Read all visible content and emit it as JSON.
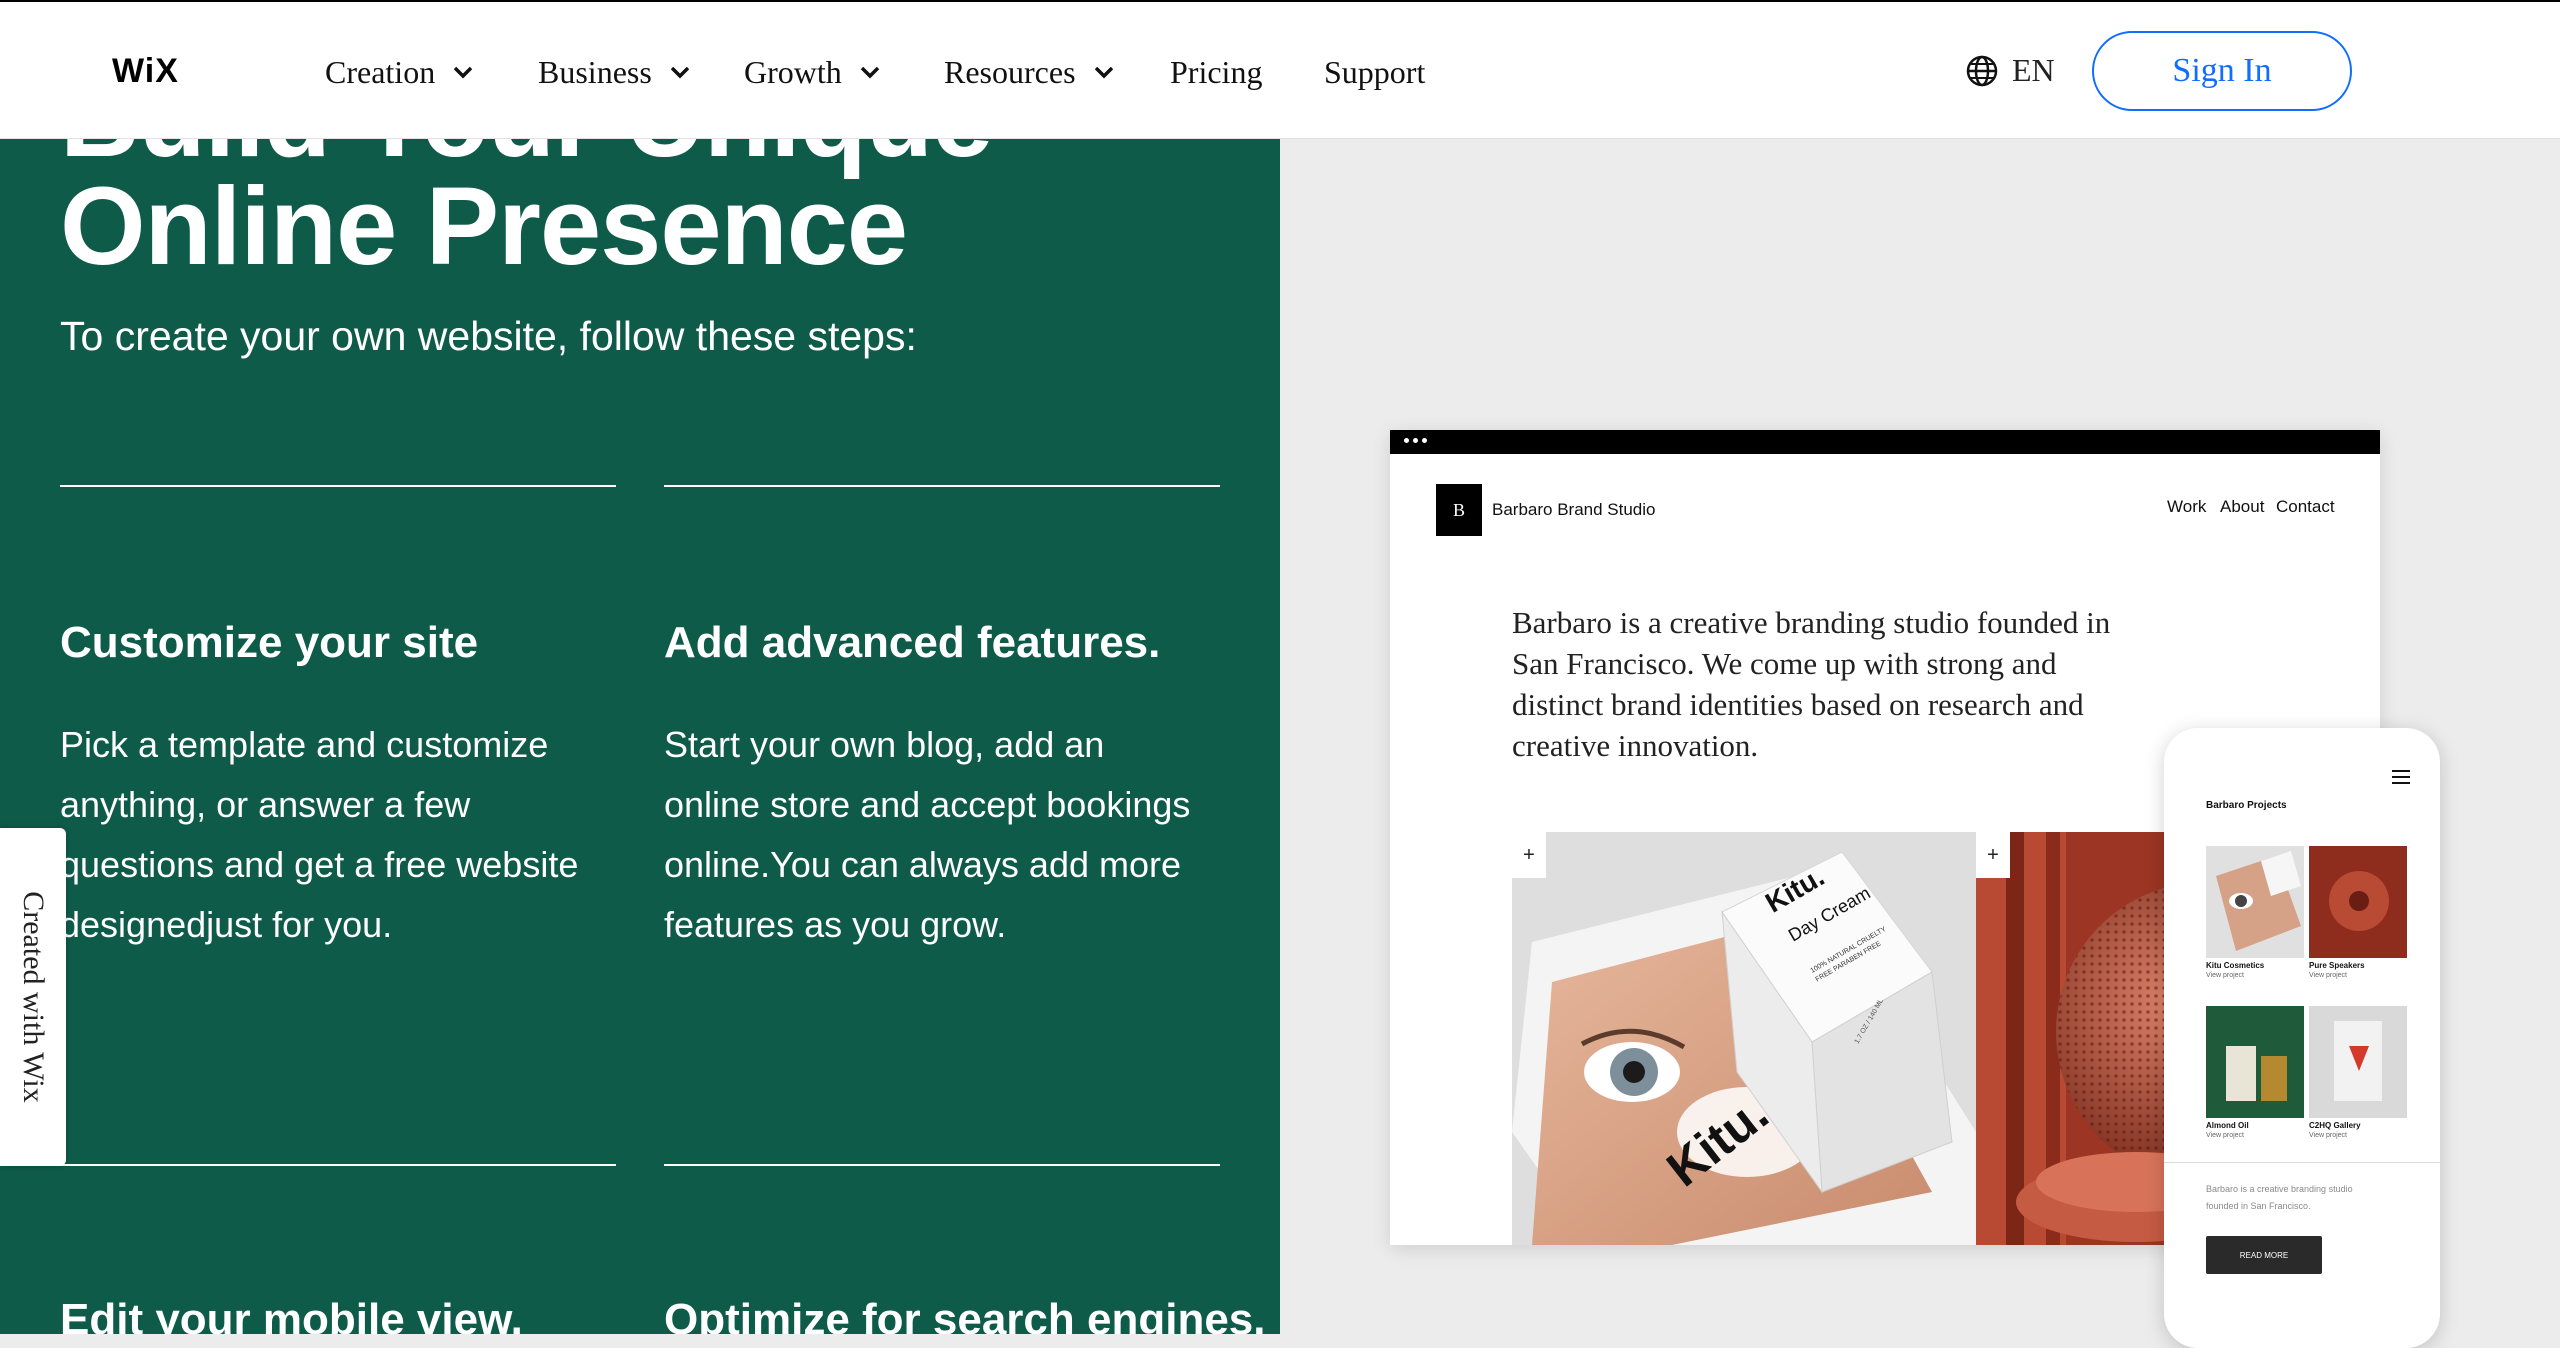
{
  "nav": {
    "logo": "WiX",
    "items": [
      {
        "label": "Creation",
        "dropdown": true
      },
      {
        "label": "Business",
        "dropdown": true
      },
      {
        "label": "Growth",
        "dropdown": true
      },
      {
        "label": "Resources",
        "dropdown": true
      },
      {
        "label": "Pricing",
        "dropdown": false
      },
      {
        "label": "Support",
        "dropdown": false
      }
    ],
    "language": "EN",
    "language_icon": "globe-icon",
    "sign_in": "Sign In",
    "accent": "#116dff"
  },
  "hero": {
    "title_top": "Build Your Unique",
    "title": "Online Presence",
    "subtitle": "To create your own website, follow these steps:",
    "background": "#0f5b4a"
  },
  "steps": [
    {
      "title": "Customize your site",
      "text": "Pick a template and customize anything, or answer a few questions and get a free website designedjust for you."
    },
    {
      "title": "Add advanced features.",
      "text": "Start your own blog, add an online store and accept bookings online.You can always add more features as you grow."
    },
    {
      "title": "Edit your mobile view.",
      "text": ""
    },
    {
      "title": "Optimize for search engines.",
      "text": ""
    }
  ],
  "wix_tab": "Created with Wix",
  "mockup": {
    "logo_letter": "B",
    "brand": "Barbaro Brand Studio",
    "nav": [
      "Work",
      "About",
      "Contact"
    ],
    "description": "Barbaro is a creative branding studio founded in San Francisco. We come up with strong and distinct brand identities based on research and creative innovation.",
    "plus": "+",
    "product": {
      "brand": "Kitu.",
      "name": "Day Cream",
      "claims": "100% NATURAL CRUELTY FREE PARABEN FREE",
      "size": "1.7 OZ / 140 ML"
    }
  },
  "phone": {
    "title": "Barbaro Projects",
    "tiles": [
      {
        "name": "Kitu Cosmetics",
        "link": "View project"
      },
      {
        "name": "Pure Speakers",
        "link": "View project"
      },
      {
        "name": "Almond Oil",
        "link": "View project"
      },
      {
        "name": "C2HQ Gallery",
        "link": "View project"
      }
    ],
    "text": "Barbaro is a creative branding studio founded in San Francisco.",
    "button": "READ MORE"
  }
}
